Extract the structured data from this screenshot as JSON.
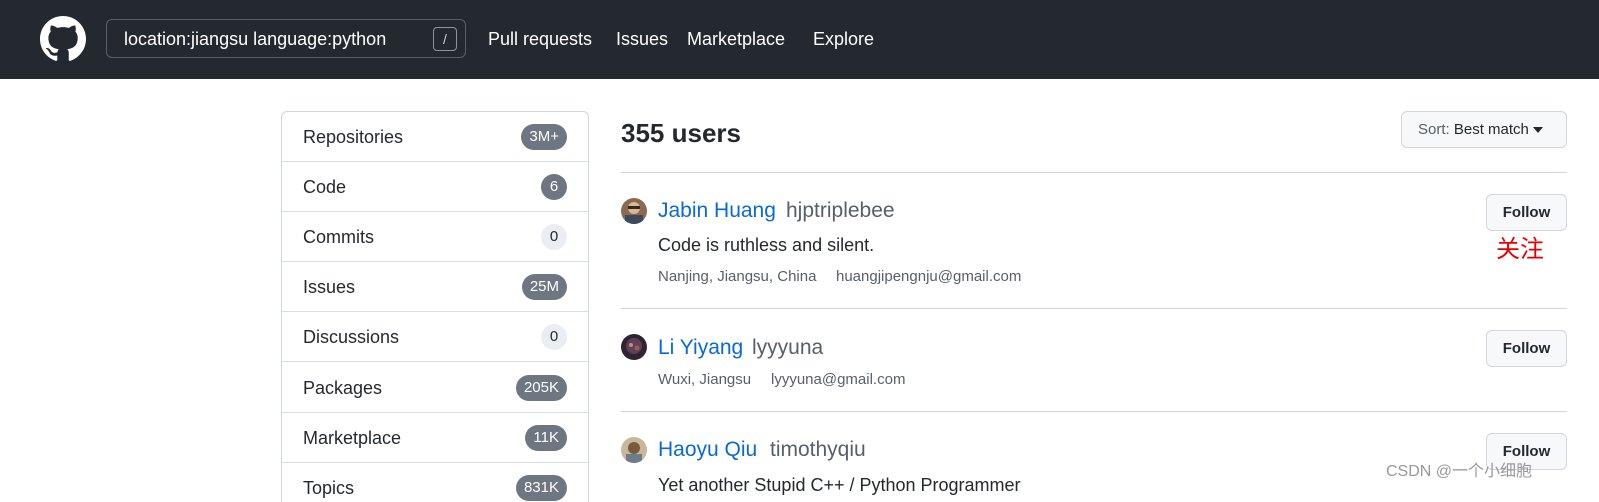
{
  "header": {
    "search": {
      "value": "location:jiangsu language:python",
      "shortcut": "/"
    },
    "nav": {
      "pull_requests": "Pull requests",
      "issues": "Issues",
      "marketplace": "Marketplace",
      "explore": "Explore"
    }
  },
  "sidebar": {
    "items": [
      {
        "label": "Repositories",
        "count": "3M+"
      },
      {
        "label": "Code",
        "count": "6"
      },
      {
        "label": "Commits",
        "count": "0"
      },
      {
        "label": "Issues",
        "count": "25M"
      },
      {
        "label": "Discussions",
        "count": "0"
      },
      {
        "label": "Packages",
        "count": "205K"
      },
      {
        "label": "Marketplace",
        "count": "11K"
      },
      {
        "label": "Topics",
        "count": "831K"
      }
    ]
  },
  "results": {
    "title": "355 users",
    "sort": {
      "prefix": "Sort: ",
      "value": "Best match"
    },
    "users": [
      {
        "name": "Jabin Huang",
        "login": "hjptriplebee",
        "bio": "Code is ruthless and silent.",
        "location": "Nanjing, Jiangsu, China",
        "email": "huangjipengnju@gmail.com",
        "follow": "Follow"
      },
      {
        "name": "Li Yiyang",
        "login": "lyyyuna",
        "location": "Wuxi, Jiangsu",
        "email": "lyyyuna@gmail.com",
        "follow": "Follow"
      },
      {
        "name": "Haoyu Qiu",
        "login": "timothyqiu",
        "bio": "Yet another Stupid C++ / Python Programmer",
        "follow": "Follow"
      }
    ]
  },
  "annotation": "关注",
  "watermark": "CSDN @一个小细胞",
  "colors": {
    "header_bg": "#24292f",
    "link": "#0969da",
    "annotation": "#e60000"
  },
  "icons": {
    "logo": "github-octocat-icon",
    "sort_caret": "caret-down-icon"
  }
}
